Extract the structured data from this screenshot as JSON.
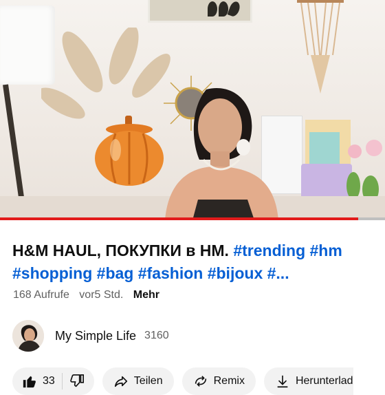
{
  "video": {
    "progress_fraction": 0.93,
    "progress_color": "#e21b1b"
  },
  "title": {
    "text_plain": "H&M HAUL, ПОКУПКИ в HM. ",
    "tags": [
      "#trending",
      "#hm",
      "#shopping",
      "#bag",
      "#fashion",
      "#bijoux",
      "#..."
    ]
  },
  "meta": {
    "views": "168 Aufrufe",
    "time": "vor5 Std.",
    "more": "Mehr"
  },
  "channel": {
    "name": "My Simple Life",
    "subscribers": "3160"
  },
  "actions": {
    "likes": "33",
    "share": "Teilen",
    "remix": "Remix",
    "download": "Herunterlad"
  },
  "icons": {
    "like": "thumbs-up-icon",
    "dislike": "thumbs-down-icon",
    "share": "share-arrow-icon",
    "remix": "remix-icon",
    "download": "download-icon"
  },
  "colors": {
    "link": "#065fd4",
    "text": "#0f0f0f",
    "secondary": "#606060",
    "pill_bg": "#f2f2f2"
  }
}
